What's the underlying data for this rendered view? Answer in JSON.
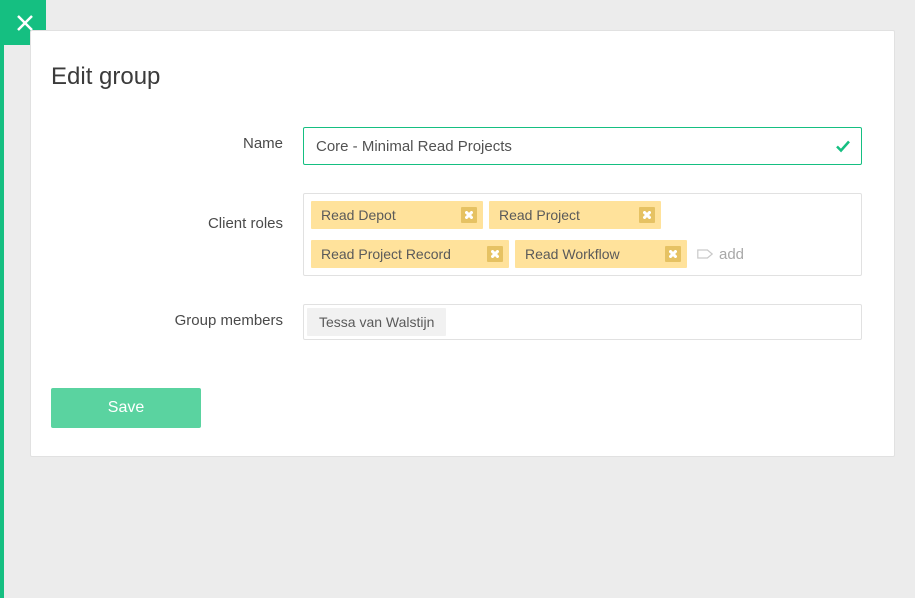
{
  "header": {
    "title": "Edit group"
  },
  "form": {
    "name_label": "Name",
    "name_value": "Core - Minimal Read Projects",
    "roles_label": "Client roles",
    "roles": [
      {
        "label": "Read Depot"
      },
      {
        "label": "Read Project"
      },
      {
        "label": "Read Project Record"
      },
      {
        "label": "Read Workflow"
      }
    ],
    "add_role_placeholder": "add",
    "members_label": "Group members",
    "members": [
      {
        "label": "Tessa van Walstijn"
      }
    ]
  },
  "actions": {
    "save_label": "Save"
  },
  "colors": {
    "accent": "#15bf81",
    "tag_bg": "#ffe29b"
  }
}
